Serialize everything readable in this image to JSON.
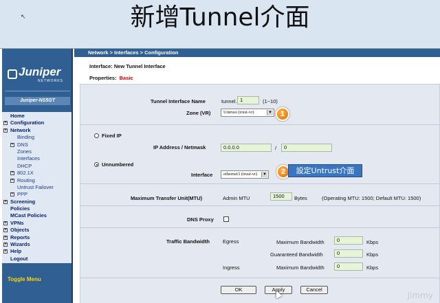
{
  "slide": {
    "title": "新增Tunnel介面"
  },
  "sidebar": {
    "logo": "Juniper",
    "logo_sub": "NETWORKS",
    "device": "Juniper-NS5GT",
    "items": [
      {
        "label": "Home",
        "level": 0,
        "expand": false
      },
      {
        "label": "Configuration",
        "level": 0,
        "expand": true
      },
      {
        "label": "Network",
        "level": 0,
        "expand": true
      },
      {
        "label": "Binding",
        "level": 1,
        "expand": false
      },
      {
        "label": "DNS",
        "level": 1,
        "expand": true
      },
      {
        "label": "Zones",
        "level": 1,
        "expand": false
      },
      {
        "label": "Interfaces",
        "level": 1,
        "expand": false
      },
      {
        "label": "DHCP",
        "level": 1,
        "expand": false
      },
      {
        "label": "802.1X",
        "level": 1,
        "expand": true
      },
      {
        "label": "Routing",
        "level": 1,
        "expand": true
      },
      {
        "label": "Untrust Failover",
        "level": 1,
        "expand": false
      },
      {
        "label": "PPP",
        "level": 1,
        "expand": true
      },
      {
        "label": "Screening",
        "level": 0,
        "expand": true
      },
      {
        "label": "Policies",
        "level": 0,
        "expand": false
      },
      {
        "label": "MCast Policies",
        "level": 0,
        "expand": false
      },
      {
        "label": "VPNs",
        "level": 0,
        "expand": true
      },
      {
        "label": "Objects",
        "level": 0,
        "expand": true
      },
      {
        "label": "Reports",
        "level": 0,
        "expand": true
      },
      {
        "label": "Wizards",
        "level": 0,
        "expand": true
      },
      {
        "label": "Help",
        "level": 0,
        "expand": true
      },
      {
        "label": "Logout",
        "level": 0,
        "expand": false
      }
    ],
    "toggle": "Toggle Menu"
  },
  "main": {
    "breadcrumb": "Network > Interfaces > Configuration",
    "heading": "Interface: New Tunnel Interface",
    "props_label": "Properties:",
    "props_value": "Basic",
    "tunnel_name_label": "Tunnel Interface Name",
    "tunnel_prefix": "tunnel.",
    "tunnel_value": "1",
    "tunnel_range": "(1~10)",
    "zone_label": "Zone (VR)",
    "zone_value": "Untrust (trust-vr)",
    "fixed_ip_label": "Fixed IP",
    "ip_label": "IP Address / Netmask",
    "ip_value": "0.0.0.0",
    "slash": "/",
    "mask_value": "0",
    "unnumbered_label": "Unnumbered",
    "interface_label": "Interface",
    "interface_value": "ethernet3 (trust-vr)",
    "mtu_label": "Maximum Transfer Unit(MTU)",
    "admin_mtu_label": "Admin MTU",
    "mtu_value": "1500",
    "mtu_unit": "Bytes",
    "mtu_info": "(Operating MTU: 1500; Default MTU: 1500)",
    "dns_proxy_label": "DNS Proxy",
    "traffic_label": "Traffic Bandwidth",
    "egress_label": "Egress",
    "max_bw_label": "Maximum Bandwidth",
    "egress_max": "0",
    "kbps": "Kbps",
    "guaranteed_label": "Guaranteed Bandwidth",
    "egress_guar": "0",
    "ingress_label": "Ingress",
    "ingress_max": "0",
    "ok_label": "OK",
    "apply_label": "Apply",
    "cancel_label": "Cancel"
  },
  "annotations": {
    "badge1": "1",
    "badge2": "2",
    "callout": "設定Untrust介面"
  },
  "watermark": "Jimmy"
}
